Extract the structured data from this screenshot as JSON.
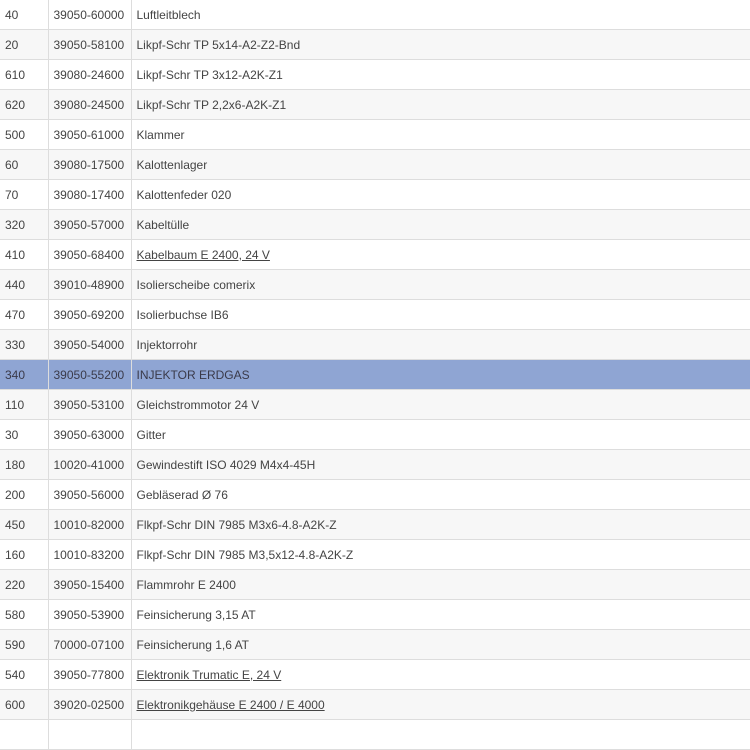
{
  "rows": [
    {
      "pos": "40",
      "part_number": "39050-60000",
      "description": "Luftleitblech",
      "link": false
    },
    {
      "pos": "20",
      "part_number": "39050-58100",
      "description": "Likpf-Schr TP 5x14-A2-Z2-Bnd",
      "link": false
    },
    {
      "pos": "610",
      "part_number": "39080-24600",
      "description": "Likpf-Schr TP 3x12-A2K-Z1",
      "link": false
    },
    {
      "pos": "620",
      "part_number": "39080-24500",
      "description": "Likpf-Schr TP 2,2x6-A2K-Z1",
      "link": false
    },
    {
      "pos": "500",
      "part_number": "39050-61000",
      "description": "Klammer",
      "link": false
    },
    {
      "pos": "60",
      "part_number": "39080-17500",
      "description": "Kalottenlager",
      "link": false
    },
    {
      "pos": "70",
      "part_number": "39080-17400",
      "description": "Kalottenfeder 020",
      "link": false
    },
    {
      "pos": "320",
      "part_number": "39050-57000",
      "description": "Kabeltülle",
      "link": false
    },
    {
      "pos": "410",
      "part_number": "39050-68400",
      "description": "Kabelbaum E 2400, 24 V",
      "link": true
    },
    {
      "pos": "440",
      "part_number": "39010-48900",
      "description": "Isolierscheibe comerix",
      "link": false
    },
    {
      "pos": "470",
      "part_number": "39050-69200",
      "description": "Isolierbuchse IB6",
      "link": false
    },
    {
      "pos": "330",
      "part_number": "39050-54000",
      "description": "Injektorrohr",
      "link": false
    },
    {
      "pos": "340",
      "part_number": "39050-55200",
      "description": "INJEKTOR ERDGAS",
      "link": false,
      "selected": true
    },
    {
      "pos": "110",
      "part_number": "39050-53100",
      "description": "Gleichstrommotor 24 V",
      "link": false
    },
    {
      "pos": "30",
      "part_number": "39050-63000",
      "description": "Gitter",
      "link": false
    },
    {
      "pos": "180",
      "part_number": "10020-41000",
      "description": "Gewindestift ISO 4029 M4x4-45H",
      "link": false
    },
    {
      "pos": "200",
      "part_number": "39050-56000",
      "description": "Gebläserad Ø 76",
      "link": false
    },
    {
      "pos": "450",
      "part_number": "10010-82000",
      "description": "Flkpf-Schr DIN 7985 M3x6-4.8-A2K-Z",
      "link": false
    },
    {
      "pos": "160",
      "part_number": "10010-83200",
      "description": "Flkpf-Schr DIN 7985 M3,5x12-4.8-A2K-Z",
      "link": false
    },
    {
      "pos": "220",
      "part_number": "39050-15400",
      "description": "Flammrohr E 2400",
      "link": false
    },
    {
      "pos": "580",
      "part_number": "39050-53900",
      "description": "Feinsicherung 3,15 AT",
      "link": false
    },
    {
      "pos": "590",
      "part_number": "70000-07100",
      "description": "Feinsicherung 1,6 AT",
      "link": false
    },
    {
      "pos": "540",
      "part_number": "39050-77800",
      "description": "Elektronik Trumatic E, 24 V",
      "link": true
    },
    {
      "pos": "600",
      "part_number": "39020-02500",
      "description": "Elektronikgehäuse E 2400 / E 4000",
      "link": true
    },
    {
      "pos": "",
      "part_number": "",
      "description": "",
      "link": false
    }
  ]
}
